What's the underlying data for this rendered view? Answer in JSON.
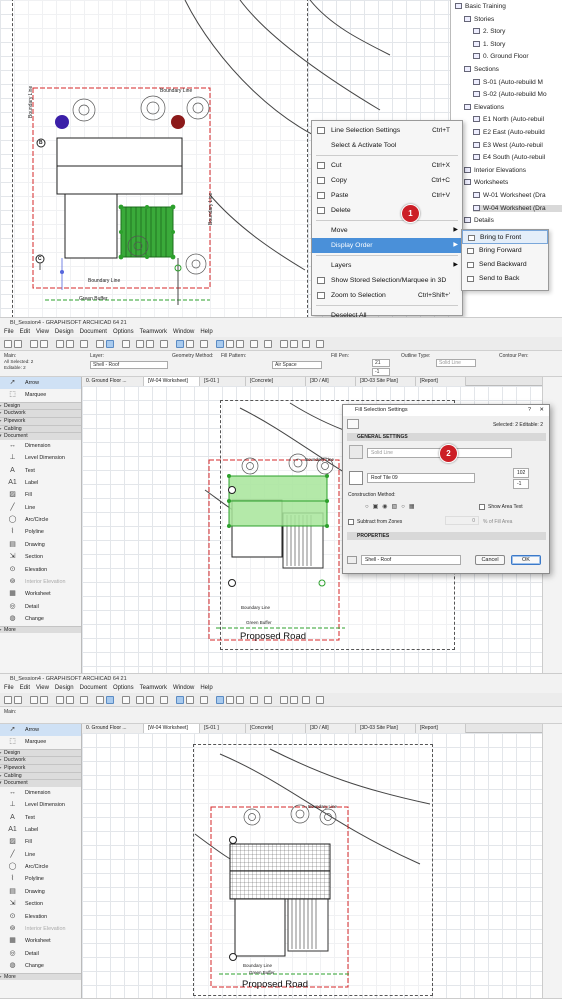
{
  "panel1": {
    "labels": {
      "boundary_top": "Boundary Line",
      "boundary_left": "Boundary Line",
      "boundary_right": "Boundary Line",
      "boundary_bottom": "Boundary Line",
      "green_buffer": "Green Buffer",
      "marker_b": "B",
      "marker_c": "C"
    },
    "context_menu": [
      {
        "label": "Line Selection Settings",
        "shortcut": "Ctrl+T",
        "icon": "line-settings-icon"
      },
      {
        "label": "Select & Activate Tool",
        "shortcut": "",
        "icon": ""
      },
      {
        "sep": true
      },
      {
        "label": "Cut",
        "shortcut": "Ctrl+X",
        "icon": "cut-icon"
      },
      {
        "label": "Copy",
        "shortcut": "Ctrl+C",
        "icon": "copy-icon"
      },
      {
        "label": "Paste",
        "shortcut": "Ctrl+V",
        "icon": "paste-icon"
      },
      {
        "label": "Delete",
        "shortcut": "",
        "icon": "delete-icon"
      },
      {
        "sep": true
      },
      {
        "label": "Move",
        "shortcut": "",
        "icon": "",
        "arrow": true
      },
      {
        "label": "Display Order",
        "shortcut": "",
        "icon": "",
        "arrow": true,
        "highlight": true
      },
      {
        "sep": true
      },
      {
        "label": "Layers",
        "shortcut": "",
        "icon": "",
        "arrow": true
      },
      {
        "label": "Show Stored Selection/Marquee in 3D",
        "shortcut": "",
        "icon": "show-3d-icon"
      },
      {
        "label": "Zoom to Selection",
        "shortcut": "Ctrl+Shift+'",
        "icon": "zoom-icon"
      },
      {
        "sep": true
      },
      {
        "label": "Deselect All",
        "shortcut": "",
        "icon": ""
      }
    ],
    "submenu": [
      {
        "label": "Bring to Front",
        "highlight": true
      },
      {
        "label": "Bring Forward"
      },
      {
        "label": "Send Backward"
      },
      {
        "label": "Send to Back"
      }
    ],
    "navigator": [
      {
        "label": "Basic Training",
        "level": 0
      },
      {
        "label": "Stories",
        "level": 1
      },
      {
        "label": "2. Story",
        "level": 2
      },
      {
        "label": "1. Story",
        "level": 2
      },
      {
        "label": "0. Ground Floor",
        "level": 2
      },
      {
        "label": "Sections",
        "level": 1
      },
      {
        "label": "S-01 (Auto-rebuild M",
        "level": 2
      },
      {
        "label": "S-02 (Auto-rebuild Mo",
        "level": 2
      },
      {
        "label": "Elevations",
        "level": 1
      },
      {
        "label": "E1 North (Auto-rebuil",
        "level": 2
      },
      {
        "label": "E2 East (Auto-rebuild",
        "level": 2
      },
      {
        "label": "E3 West (Auto-rebuil",
        "level": 2
      },
      {
        "label": "E4 South (Auto-rebuil",
        "level": 2
      },
      {
        "label": "Interior Elevations",
        "level": 1
      },
      {
        "label": "Worksheets",
        "level": 1
      },
      {
        "label": "W-01 Worksheet (Dra",
        "level": 2
      },
      {
        "label": "W-04 Worksheet (Dra",
        "level": 2,
        "selected": true
      },
      {
        "label": "Details",
        "level": 1
      }
    ],
    "badge": "1"
  },
  "app": {
    "title2": "BI_Session4 - GRAPHISOFT ARCHICAD 64 21",
    "title3": "BI_Session4 - GRAPHISOFT ARCHICAD 64 21",
    "menus": [
      "File",
      "Edit",
      "View",
      "Design",
      "Document",
      "Options",
      "Teamwork",
      "Window",
      "Help"
    ],
    "tabs": [
      "0. Ground Floor ...",
      "[W-04 Worksheet]",
      "[S-01 ]",
      "[Concrete]",
      "[3D / All]",
      "[3D-03 Site Plan]",
      "[Report]"
    ],
    "toolbox_top": [
      {
        "label": "Arrow",
        "glyph": "➚",
        "active": true
      },
      {
        "label": "Marquee",
        "glyph": "⬚"
      }
    ],
    "categories": [
      "Design",
      "Ductwork",
      "Pipework",
      "Cabling",
      "Document"
    ],
    "tools": [
      {
        "label": "Dimension",
        "glyph": "↔"
      },
      {
        "label": "Level Dimension",
        "glyph": "⊥"
      },
      {
        "label": "Text",
        "glyph": "A"
      },
      {
        "label": "Label",
        "glyph": "A1"
      },
      {
        "label": "Fill",
        "glyph": "▨"
      },
      {
        "label": "Line",
        "glyph": "╱"
      },
      {
        "label": "Arc/Circle",
        "glyph": "◯"
      },
      {
        "label": "Polyline",
        "glyph": "⌇"
      },
      {
        "label": "Drawing",
        "glyph": "▤"
      },
      {
        "label": "Section",
        "glyph": "⇲"
      },
      {
        "label": "Elevation",
        "glyph": "⊙"
      },
      {
        "label": "Interior Elevation",
        "glyph": "⊚",
        "dim": true
      },
      {
        "label": "Worksheet",
        "glyph": "▦"
      },
      {
        "label": "Detail",
        "glyph": "◎"
      },
      {
        "label": "Change",
        "glyph": "◍"
      }
    ],
    "more": "More"
  },
  "panel2": {
    "info": {
      "main": "Main:",
      "selected": "All Selected: 2",
      "editable": "Editable: 2",
      "layer_label": "Layer:",
      "layer": "Shell - Roof",
      "geometry_label": "Geometry Method:",
      "fill_pattern_label": "Fill Pattern:",
      "fill_pattern": "Air Space",
      "fill_pen_label": "Fill Pen:",
      "pen1": "21",
      "pen2": "-1",
      "outline_label": "Outline Type:",
      "outline": "Solid Line",
      "contour_label": "Contour Pen:"
    },
    "dialog": {
      "title": "Fill Selection Settings",
      "selected": "Selected: 2 Editable: 2",
      "general": "GENERAL SETTINGS",
      "line_type": "Solid Line",
      "fill_type": "Roof Tile 09",
      "pen_fg": "102",
      "pen_bg": "-1",
      "construction": "Construction Method:",
      "show_area": "Show Area Text",
      "subtract": "Subtract from Zones",
      "percent": "0",
      "percent_label": "% of Fill Area",
      "properties": "PROPERTIES",
      "layer": "Shell - Roof",
      "cancel": "Cancel",
      "ok": "OK"
    },
    "road": "Proposed Road",
    "boundary": "Boundary Line",
    "green_buffer": "Green Buffer",
    "badge": "2"
  },
  "panel3": {
    "main": "Main:",
    "road": "Proposed Road",
    "boundary": "Boundary Line",
    "green_buffer": "Green Buffer"
  },
  "colors": {
    "highlight": "#4a90d9",
    "badge": "#cc1f27",
    "selection_green": "#2ca02c",
    "boundary_red": "#d62728"
  }
}
